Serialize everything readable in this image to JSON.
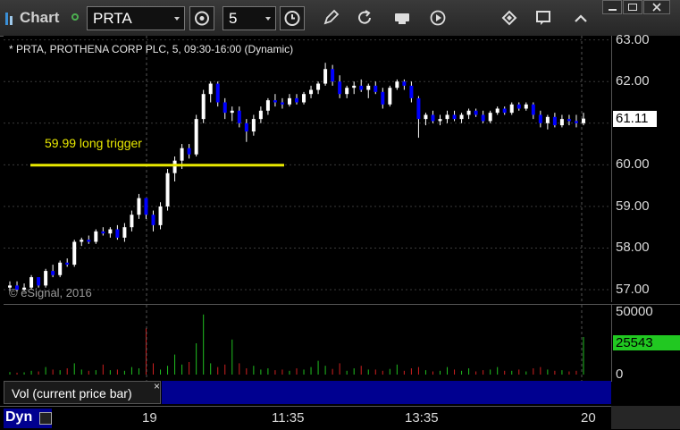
{
  "toolbar": {
    "title": "Chart",
    "symbol": "PRTA",
    "interval": "5"
  },
  "chart": {
    "title": "* PRTA, PROTHENA CORP PLC, 5, 09:30-16:00 (Dynamic)",
    "watermark": "© eSignal, 2016",
    "annotation": "59.99 long trigger",
    "current_price": "61.11",
    "price_ticks": [
      "63.00",
      "62.00",
      "61.00",
      "60.00",
      "59.00",
      "58.00",
      "57.00"
    ],
    "volume_ticks": [
      "50000",
      "0"
    ],
    "current_volume": "25543",
    "volume_study_label": "Vol (current price bar)",
    "time_labels": [
      "19",
      "11:35",
      "13:35",
      "20"
    ],
    "mode_label": "Dyn",
    "colors": {
      "up_candle": "#ffffff",
      "down_candle": "#0000ff",
      "trigger_line": "#e8e800",
      "up_volume": "#20c020",
      "down_volume": "#d02020",
      "grid": "#3a3a3a"
    }
  },
  "chart_data": {
    "type": "candlestick",
    "ylim": [
      56.7,
      63.1
    ],
    "trigger_level": 59.99,
    "candles": [
      [
        57.05,
        57.2,
        56.95,
        57.1
      ],
      [
        57.1,
        57.2,
        56.95,
        57.0
      ],
      [
        57.0,
        57.15,
        56.95,
        57.05
      ],
      [
        57.05,
        57.35,
        57.0,
        57.3
      ],
      [
        57.3,
        57.3,
        57.05,
        57.1
      ],
      [
        57.1,
        57.5,
        57.05,
        57.45
      ],
      [
        57.45,
        57.6,
        57.3,
        57.35
      ],
      [
        57.35,
        57.7,
        57.3,
        57.65
      ],
      [
        57.65,
        57.75,
        57.55,
        57.6
      ],
      [
        57.6,
        58.2,
        57.55,
        58.15
      ],
      [
        58.15,
        58.25,
        58.05,
        58.2
      ],
      [
        58.2,
        58.3,
        58.1,
        58.15
      ],
      [
        58.15,
        58.45,
        58.1,
        58.4
      ],
      [
        58.4,
        58.5,
        58.3,
        58.35
      ],
      [
        58.35,
        58.5,
        58.25,
        58.45
      ],
      [
        58.45,
        58.55,
        58.2,
        58.25
      ],
      [
        58.25,
        58.6,
        58.15,
        58.5
      ],
      [
        58.5,
        58.9,
        58.4,
        58.8
      ],
      [
        58.8,
        59.3,
        58.7,
        59.2
      ],
      [
        59.2,
        59.2,
        58.7,
        58.8
      ],
      [
        58.8,
        58.9,
        58.4,
        58.55
      ],
      [
        58.55,
        59.1,
        58.45,
        59.0
      ],
      [
        59.0,
        59.9,
        58.9,
        59.8
      ],
      [
        59.8,
        60.2,
        59.6,
        60.1
      ],
      [
        60.1,
        60.5,
        59.9,
        60.4
      ],
      [
        60.4,
        60.5,
        60.15,
        60.25
      ],
      [
        60.25,
        61.2,
        60.2,
        61.1
      ],
      [
        61.1,
        61.8,
        61.0,
        61.7
      ],
      [
        61.7,
        62.0,
        61.5,
        61.95
      ],
      [
        61.95,
        62.0,
        61.4,
        61.5
      ],
      [
        61.5,
        61.6,
        61.1,
        61.25
      ],
      [
        61.25,
        61.4,
        61.05,
        61.3
      ],
      [
        61.3,
        61.4,
        60.9,
        61.0
      ],
      [
        61.0,
        61.1,
        60.55,
        60.8
      ],
      [
        60.8,
        61.2,
        60.7,
        61.1
      ],
      [
        61.1,
        61.4,
        61.0,
        61.3
      ],
      [
        61.3,
        61.6,
        61.2,
        61.55
      ],
      [
        61.55,
        61.7,
        61.4,
        61.5
      ],
      [
        61.5,
        61.6,
        61.35,
        61.45
      ],
      [
        61.45,
        61.7,
        61.4,
        61.6
      ],
      [
        61.6,
        61.7,
        61.45,
        61.5
      ],
      [
        61.5,
        61.75,
        61.45,
        61.7
      ],
      [
        61.7,
        61.9,
        61.6,
        61.8
      ],
      [
        61.8,
        62.0,
        61.7,
        61.95
      ],
      [
        61.95,
        62.45,
        61.9,
        62.3
      ],
      [
        62.3,
        62.4,
        61.9,
        62.0
      ],
      [
        62.0,
        62.15,
        61.6,
        61.7
      ],
      [
        61.7,
        61.9,
        61.6,
        61.85
      ],
      [
        61.85,
        62.0,
        61.7,
        61.9
      ],
      [
        61.9,
        62.05,
        61.75,
        61.8
      ],
      [
        61.8,
        61.95,
        61.6,
        61.9
      ],
      [
        61.9,
        62.0,
        61.7,
        61.75
      ],
      [
        61.75,
        61.85,
        61.35,
        61.45
      ],
      [
        61.45,
        61.9,
        61.4,
        61.85
      ],
      [
        61.85,
        62.05,
        61.8,
        62.0
      ],
      [
        62.0,
        62.05,
        61.8,
        61.9
      ],
      [
        61.9,
        62.0,
        61.5,
        61.6
      ],
      [
        61.6,
        61.65,
        60.65,
        61.1
      ],
      [
        61.1,
        61.25,
        60.95,
        61.2
      ],
      [
        61.2,
        61.3,
        61.0,
        61.05
      ],
      [
        61.05,
        61.2,
        60.95,
        61.1
      ],
      [
        61.1,
        61.3,
        61.0,
        61.2
      ],
      [
        61.2,
        61.3,
        61.05,
        61.1
      ],
      [
        61.1,
        61.25,
        61.0,
        61.2
      ],
      [
        61.2,
        61.35,
        61.1,
        61.3
      ],
      [
        61.3,
        61.35,
        61.15,
        61.2
      ],
      [
        61.2,
        61.3,
        61.0,
        61.05
      ],
      [
        61.05,
        61.3,
        61.0,
        61.25
      ],
      [
        61.25,
        61.4,
        61.2,
        61.35
      ],
      [
        61.35,
        61.4,
        61.2,
        61.25
      ],
      [
        61.25,
        61.5,
        61.2,
        61.45
      ],
      [
        61.45,
        61.5,
        61.3,
        61.35
      ],
      [
        61.35,
        61.5,
        61.3,
        61.45
      ],
      [
        61.45,
        61.5,
        61.1,
        61.2
      ],
      [
        61.2,
        61.3,
        60.9,
        61.0
      ],
      [
        61.0,
        61.2,
        60.85,
        61.15
      ],
      [
        61.15,
        61.25,
        60.9,
        60.95
      ],
      [
        60.95,
        61.2,
        60.9,
        61.1
      ],
      [
        61.1,
        61.2,
        60.95,
        61.05
      ],
      [
        61.05,
        61.2,
        60.9,
        61.0
      ],
      [
        61.0,
        61.25,
        60.95,
        61.11
      ]
    ],
    "volumes": [
      2000,
      1500,
      1800,
      3000,
      2500,
      6000,
      4000,
      3500,
      5000,
      9000,
      4000,
      3000,
      3500,
      8000,
      3500,
      4000,
      3000,
      6000,
      5000,
      37000,
      9000,
      4000,
      7000,
      16000,
      8000,
      10000,
      25000,
      48000,
      9000,
      6000,
      8000,
      28000,
      9000,
      5000,
      7000,
      4000,
      5000,
      3500,
      4000,
      3000,
      5000,
      4000,
      6000,
      11000,
      7000,
      4500,
      9000,
      3000,
      5000,
      7000,
      4000,
      4000,
      3000,
      4500,
      8000,
      3000,
      5000,
      6000,
      3500,
      2500,
      3000,
      6000,
      4000,
      3000,
      5000,
      2500,
      3500,
      4000,
      6000,
      3000,
      3000,
      4000,
      2500,
      5000,
      6000,
      4000,
      3000,
      3500,
      2500,
      3000,
      30000
    ]
  }
}
